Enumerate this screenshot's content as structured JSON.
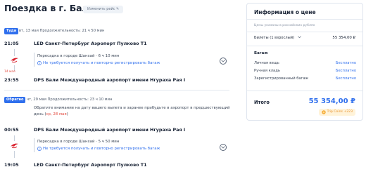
{
  "page": {
    "title": "Поездка в г. Бали",
    "change_flight": "Изменить рейс ✎"
  },
  "outbound": {
    "badge": "Туда",
    "meta": "вт, 13 мая   Продолжительность: 21 ч 50 мин",
    "depart_time": "21:05",
    "depart_airport": "LED Санкт-Петербург Аэропорт Пулково Т1",
    "transfer_text": "Пересадка в городе Шанхай · 6 ч 10 мин",
    "transfer_note": "Не требуется получать и повторно регистрировать багаж",
    "next_day": "14 мая",
    "arrive_time": "23:55",
    "arrive_airport": "DPS Бали Международный аэропорт имени Нгураха Рая I"
  },
  "inbound": {
    "badge": "Обратно",
    "meta": "чт, 29 мая   Продолжительность: 23 ч 10 мин",
    "notice_text": "Обратите внимание на дату вашего вылета и заранее прибудьте в аэропорт в предшествующий день (",
    "notice_date": "ср, 28 мая",
    "notice_end": ")",
    "depart_time": "00:55",
    "depart_airport": "DPS Бали Международный аэропорт имени Нгураха Рая I",
    "transfer_text": "Пересадка в городе Шанхай · 5 ч 50 мин",
    "transfer_note": "Не требуется получать и повторно регистрировать багаж",
    "arrive_time": "19:05",
    "arrive_airport": "LED Санкт-Петербург Аэропорт Пулково Т1"
  },
  "price": {
    "title": "Информация о цене",
    "subtitle": "Цены указаны в российских рублях",
    "tickets_label": "Билеты (1 взрослый)",
    "tickets_value": "55 354,00 ₽",
    "baggage_title": "Багаж",
    "baggage": [
      {
        "label": "Личная вещь",
        "value": "Бесплатно"
      },
      {
        "label": "Ручная кладь",
        "value": "Бесплатно"
      },
      {
        "label": "Зарегистрированный багаж",
        "value": "Бесплатно"
      }
    ],
    "total_label": "Итого",
    "total_value": "55 354,00 ₽",
    "coins": "Trip Coins +223"
  },
  "colors": {
    "accent": "#2f6fed",
    "warning": "#e2483d",
    "airline_red": "#d9232f"
  }
}
